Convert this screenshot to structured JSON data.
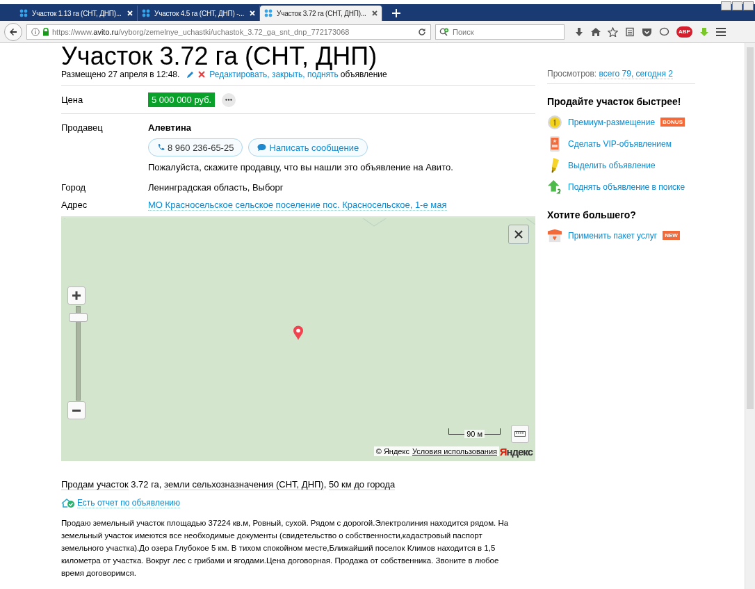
{
  "browser": {
    "tabs": [
      {
        "title": "Участок 1.13 га (СНТ, ДНП)...",
        "selected": false
      },
      {
        "title": "Участок 4.5 га (СНТ, ДНП) -...",
        "selected": false
      },
      {
        "title": "Участок 3.72 га (СНТ, ДНП)...",
        "selected": true
      }
    ],
    "url": {
      "scheme": "https://www.",
      "domain": "avito.ru",
      "path": "/vyborg/zemelnye_uchastki/uchastok_3.72_ga_snt_dnp_772173068"
    },
    "search": {
      "placeholder": "Поиск"
    },
    "adblock_label": "ABP"
  },
  "listing": {
    "title": "Участок 3.72 га (СНТ, ДНП)",
    "posted": "Размещено 27 апреля в 12:48.",
    "edit_links": "Редактировать, закрыть, поднять",
    "edit_suffix": "объявление",
    "price": {
      "label": "Цена",
      "value": "5 000 000 руб."
    },
    "seller": {
      "label": "Продавец",
      "name": "Алевтина",
      "phone": "8 960 236-65-25",
      "message_button": "Написать сообщение",
      "hint": "Пожалуйста, скажите продавцу, что вы нашли это объявление на Авито."
    },
    "city": {
      "label": "Город",
      "value": "Ленинградская область, Выборг"
    },
    "address": {
      "label": "Адрес",
      "value": "МО Красносельское сельское поселение пос. Красносельское, 1-е мая"
    },
    "map": {
      "zoom": {
        "level": 0.87
      },
      "scale": "90 м",
      "copyright": "© Яндекс",
      "terms": "Условия использования",
      "logo_first": "Я",
      "logo_rest": "ндекс"
    },
    "summary": [
      {
        "kind": "link",
        "text": "Продам участок"
      },
      {
        "kind": "text",
        "text": " 3.72 га, "
      },
      {
        "kind": "link",
        "text": "земли сельхозназначения (СНТ, ДНП)"
      },
      {
        "kind": "text",
        "text": ", "
      },
      {
        "kind": "link",
        "text": "50 км до города"
      }
    ],
    "report_link": "Есть отчет по объявлению",
    "description": "Продаю земельный участок площадью 37224 кв.м, Ровный, сухой. Рядом с дорогой.Электролиния находится рядом. На земельный участок имеются все необходимые документы (свидетельство о собственности,кадастровый паспорт земельного участка).До озера Глубокое 5 км. В тихом спокойном месте,Ближайший поселок Климов находится в 1,5 километра от участка. Вокруг лес с грибами и ягодами.Цена договорная. Продажа от собственника. Звоните в любое время договоримся."
  },
  "sidebar": {
    "views_label": "Просмотров:",
    "views_value": "всего 79, сегодня 2",
    "sections": [
      {
        "heading": "Продайте участок быстрее!",
        "items": [
          {
            "label": "Премиум-размещение",
            "badge": "BONUS"
          },
          {
            "label": "Сделать VIP-объявлением"
          },
          {
            "label": "Выделить объявление"
          },
          {
            "label": "Поднять объявление в поиске"
          }
        ]
      },
      {
        "heading": "Хотите большего?",
        "items": [
          {
            "label": "Применить пакет услуг",
            "badge": "NEW"
          }
        ]
      }
    ]
  }
}
